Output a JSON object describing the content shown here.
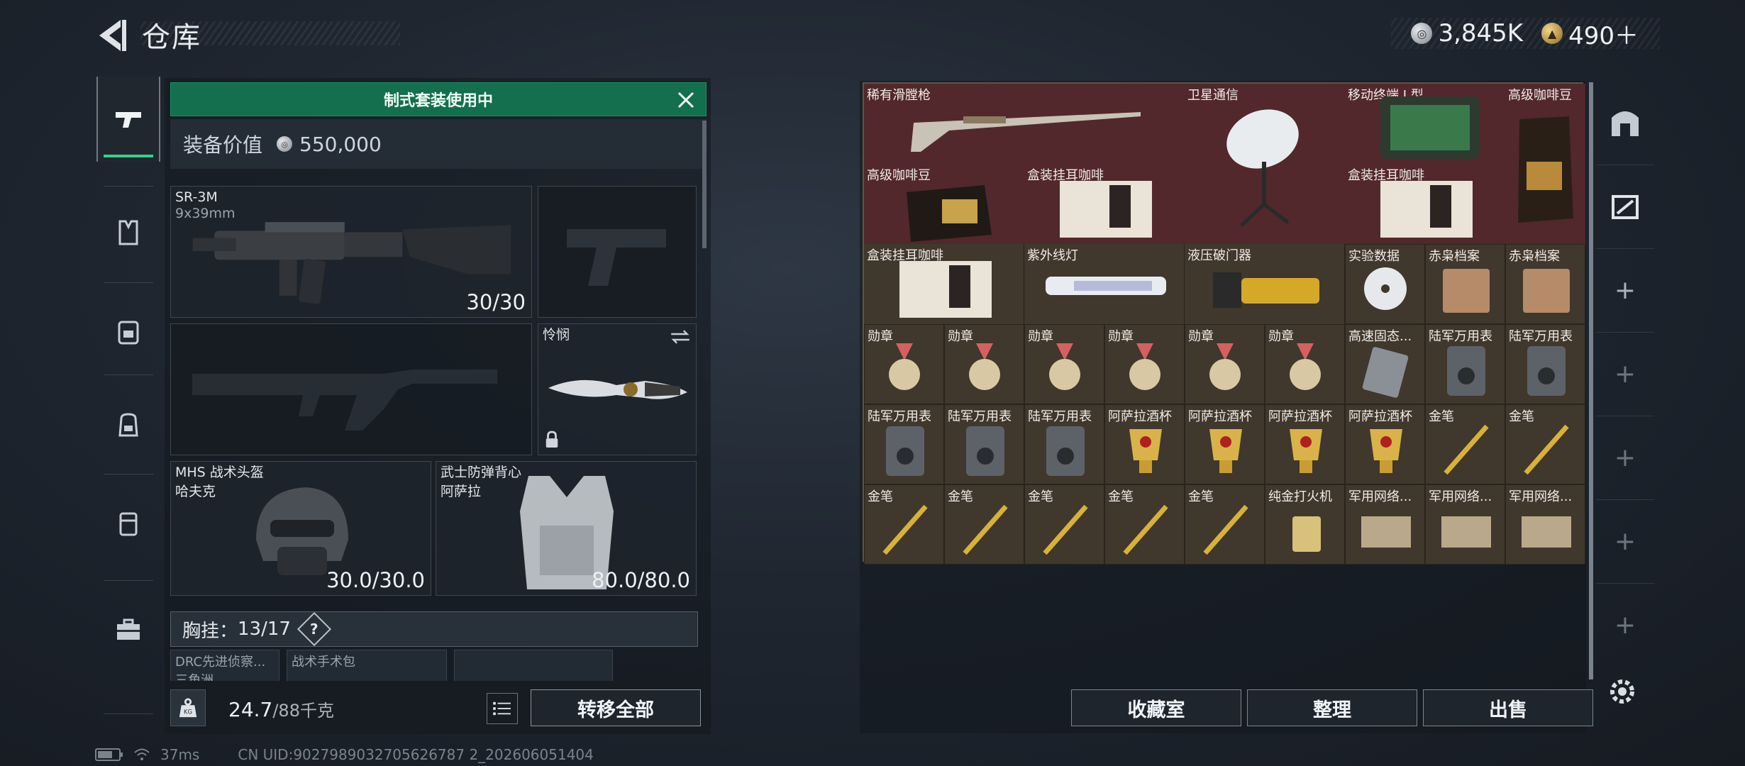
{
  "header": {
    "title": "仓库"
  },
  "currency": [
    {
      "icon": "silver-coin-icon",
      "value": "3,845K"
    },
    {
      "icon": "gold-coin-icon",
      "value": "490＋"
    }
  ],
  "sidebar": {
    "items": [
      {
        "icon": "weapon-pistol-icon",
        "active": true
      },
      {
        "icon": "armor-vest-icon"
      },
      {
        "icon": "chest-rig-icon"
      },
      {
        "icon": "backpack-icon"
      },
      {
        "icon": "pouch-icon"
      },
      {
        "icon": "toolbox-icon"
      }
    ]
  },
  "loadout": {
    "banner": "制式套装使用中",
    "value_label": "装备价值",
    "value": "550,000",
    "primary": {
      "name": "SR-3M",
      "caliber": "9x39mm",
      "ammo": "30/30"
    },
    "melee": {
      "name": "怜悯"
    },
    "helmet": {
      "name": "MHS 战术头盔",
      "variant": "哈夫克",
      "durability": "30.0/30.0"
    },
    "vest": {
      "name": "武士防弹背心",
      "variant": "阿萨拉",
      "durability": "80.0/80.0"
    },
    "chest_rig": {
      "label": "胸挂：",
      "count": "13/17",
      "help": "?"
    },
    "sub_slots": [
      "DRC先进侦察... 三角洲",
      "战术手术包",
      ""
    ],
    "weight": {
      "current": "24.7",
      "max": "/88千克"
    },
    "transfer_all": "转移全部"
  },
  "inventory": {
    "items": [
      {
        "name": "稀有滑膛枪"
      },
      {
        "name": "卫星通信"
      },
      {
        "name": "移动终端 I 型"
      },
      {
        "name": "高级咖啡豆"
      },
      {
        "name": "高级咖啡豆"
      },
      {
        "name": "盒装挂耳咖啡"
      },
      {
        "name": "盒装挂耳咖啡"
      },
      {
        "name": "盒装挂耳咖啡"
      },
      {
        "name": "紫外线灯"
      },
      {
        "name": "液压破门器"
      },
      {
        "name": "实验数据"
      },
      {
        "name": "赤枭档案"
      },
      {
        "name": "赤枭档案"
      },
      {
        "name": "勋章"
      },
      {
        "name": "勋章"
      },
      {
        "name": "勋章"
      },
      {
        "name": "勋章"
      },
      {
        "name": "勋章"
      },
      {
        "name": "勋章"
      },
      {
        "name": "高速固态..."
      },
      {
        "name": "陆军万用表"
      },
      {
        "name": "陆军万用表"
      },
      {
        "name": "陆军万用表"
      },
      {
        "name": "陆军万用表"
      },
      {
        "name": "陆军万用表"
      },
      {
        "name": "阿萨拉酒杯"
      },
      {
        "name": "阿萨拉酒杯"
      },
      {
        "name": "阿萨拉酒杯"
      },
      {
        "name": "阿萨拉酒杯"
      },
      {
        "name": "金笔"
      },
      {
        "name": "金笔"
      },
      {
        "name": "金笔"
      },
      {
        "name": "金笔"
      },
      {
        "name": "金笔"
      },
      {
        "name": "金笔"
      },
      {
        "name": "金笔"
      },
      {
        "name": "纯金打火机"
      },
      {
        "name": "军用网络..."
      },
      {
        "name": "军用网络..."
      },
      {
        "name": "军用网络..."
      }
    ],
    "buttons": {
      "collection": "收藏室",
      "sort": "整理",
      "sell": "出售"
    }
  },
  "status_bar": {
    "ping": "37ms",
    "uid": "CN UID:9027989032705626787 2_202606051404"
  },
  "colors": {
    "accent_green": "#136f4e",
    "rare_cell": "#52282c",
    "common_cell": "#40372d"
  }
}
